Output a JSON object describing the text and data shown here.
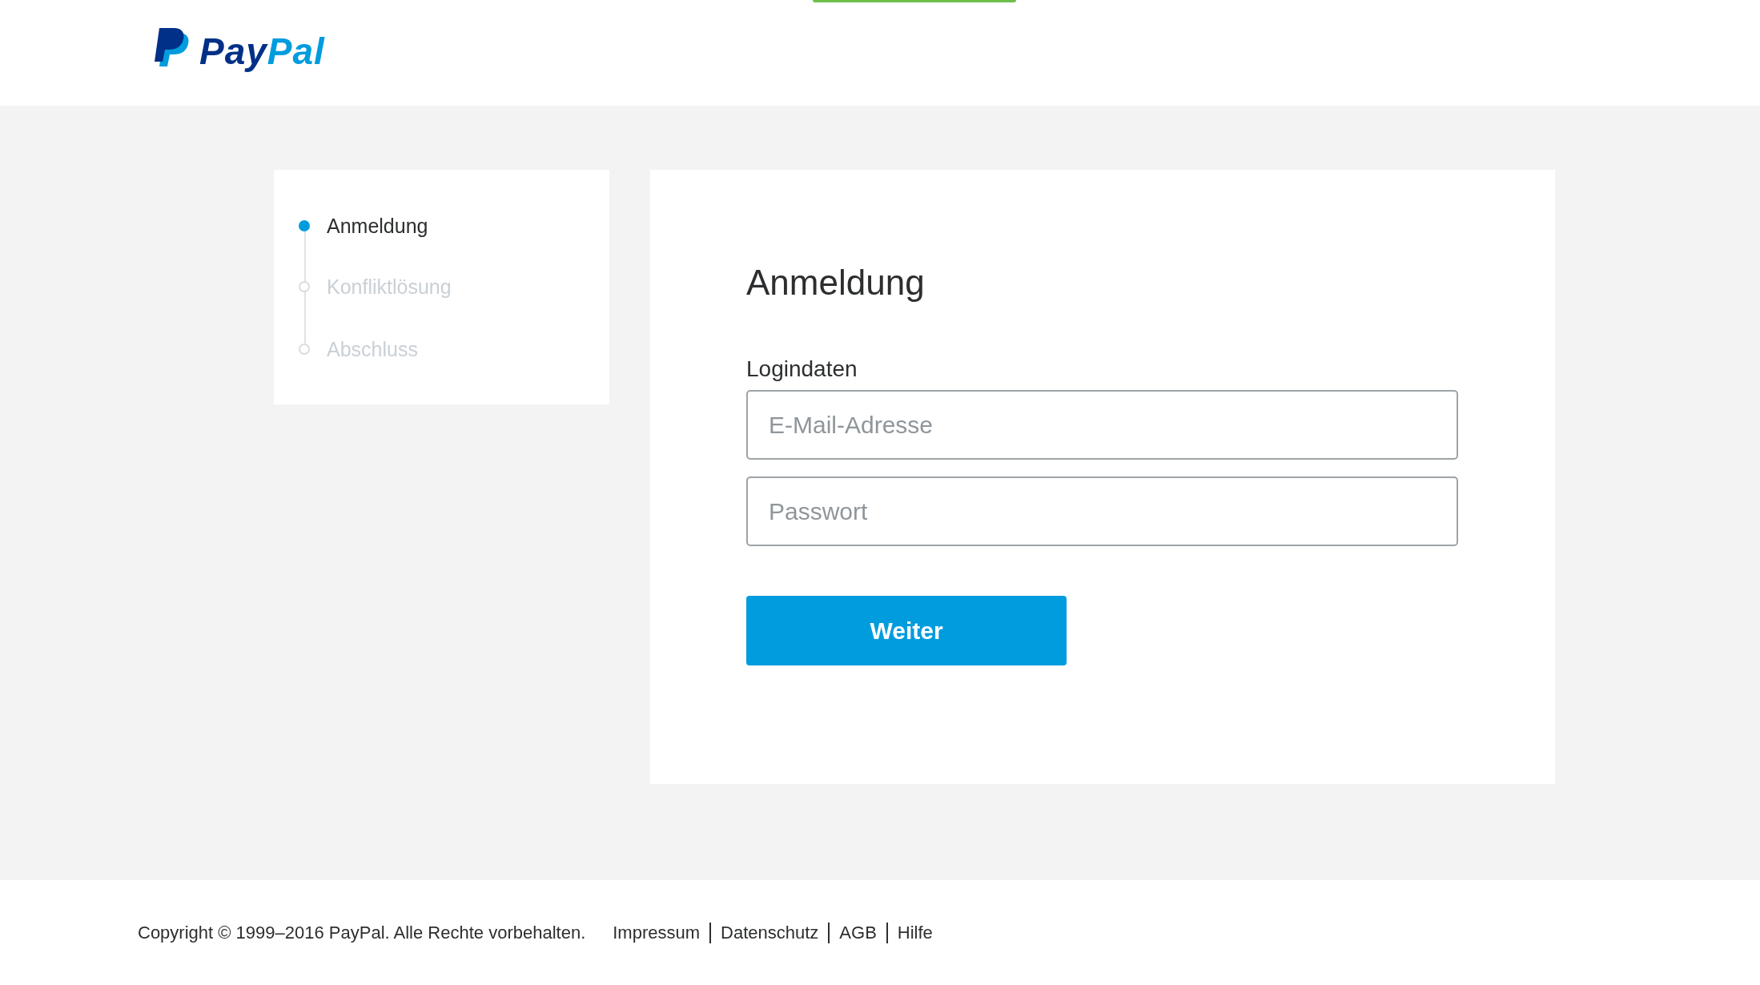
{
  "header": {
    "logo": {
      "parts": [
        "Pay",
        "Pal"
      ]
    }
  },
  "steps": [
    {
      "label": "Anmeldung",
      "selected": true
    },
    {
      "label": "Konfliktlösung",
      "selected": false
    },
    {
      "label": "Abschluss",
      "selected": false
    }
  ],
  "login": {
    "title": "Anmeldung",
    "section_label": "Logindaten",
    "fields": [
      {
        "placeholder": "E-Mail-Adresse"
      },
      {
        "placeholder": "Passwort"
      }
    ],
    "button": "Weiter"
  },
  "footer": {
    "copyright": "Copyright © 1999–2016 PayPal. Alle Rechte vorbehalten.",
    "links": [
      "Impressum",
      "Datenschutz",
      "AGB",
      "Hilfe"
    ]
  }
}
